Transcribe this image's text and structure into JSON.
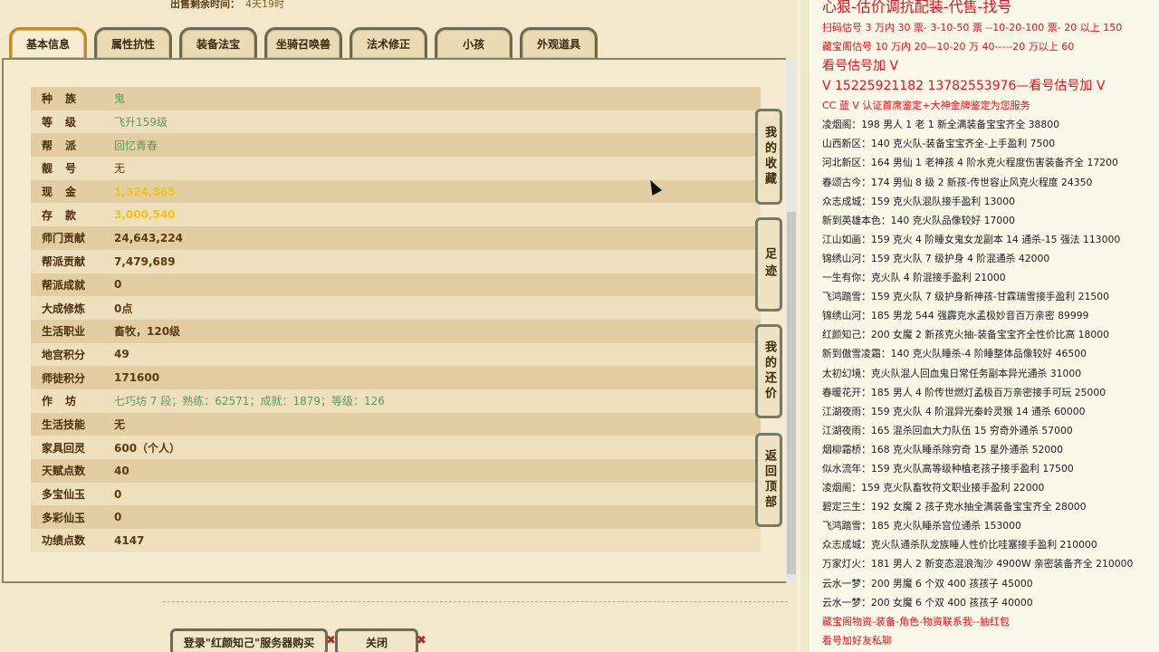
{
  "sale_time": {
    "label": "出售剩余时间：",
    "value": "4天19时"
  },
  "tabs": [
    "基本信息",
    "属性抗性",
    "装备法宝",
    "坐骑召唤兽",
    "法术修正",
    "小孩",
    "外观道具"
  ],
  "attributes": [
    {
      "label": "种族",
      "value": "鬼",
      "style": "green",
      "spaced": true
    },
    {
      "label": "等级",
      "value": "飞升159级",
      "style": "green",
      "spaced": true
    },
    {
      "label": "帮派",
      "value": "回忆青春",
      "style": "green",
      "spaced": true
    },
    {
      "label": "靓号",
      "value": "无",
      "style": "plain",
      "spaced": true
    },
    {
      "label": "现金",
      "value": "1,324,865",
      "style": "gold",
      "spaced": true
    },
    {
      "label": "存款",
      "value": "3,000,540",
      "style": "gold",
      "spaced": true
    },
    {
      "label": "师门贡献",
      "value": "24,643,224",
      "style": "bold",
      "spaced": false
    },
    {
      "label": "帮派贡献",
      "value": "7,479,689",
      "style": "bold",
      "spaced": false
    },
    {
      "label": "帮派成就",
      "value": "0",
      "style": "bold",
      "spaced": false
    },
    {
      "label": "大成修炼",
      "value": "0点",
      "style": "bold",
      "spaced": false
    },
    {
      "label": "生活职业",
      "value": "畜牧，120级",
      "style": "bold",
      "spaced": false
    },
    {
      "label": "地宫积分",
      "value": "49",
      "style": "bold",
      "spaced": false
    },
    {
      "label": "师徒积分",
      "value": "171600",
      "style": "bold",
      "spaced": false
    },
    {
      "label": "作坊",
      "value": "七巧坊 7 段；熟练：62571；成就：1879；等级：126",
      "style": "green",
      "spaced": true
    },
    {
      "label": "生活技能",
      "value": "无",
      "style": "bold",
      "spaced": false
    },
    {
      "label": "家具回灵",
      "value": "600（个人）",
      "style": "bold",
      "spaced": false
    },
    {
      "label": "天赋点数",
      "value": "40",
      "style": "bold",
      "spaced": false
    },
    {
      "label": "多宝仙玉",
      "value": "0",
      "style": "bold",
      "spaced": false
    },
    {
      "label": "多彩仙玉",
      "value": "0",
      "style": "bold",
      "spaced": false
    },
    {
      "label": "功绩点数",
      "value": "4147",
      "style": "bold",
      "spaced": false
    }
  ],
  "side_buttons": {
    "favorites": "我的收藏",
    "footprint": "足迹",
    "bargain": "我的还价",
    "back_top": "返回顶部"
  },
  "bottom_buttons": {
    "login": "登录\"红颜知己\"服务器购买",
    "close": "关闭",
    "x": "✖"
  },
  "ad": {
    "title": "心狠-估价调抗配装-代售-找号",
    "lines": [
      {
        "text": "扫码估号 3 万内 30 票- 3-10-50 票 --10-20-100 票- 20 以上 150",
        "cls": "red"
      },
      {
        "text": "藏宝阁估号 10 万内 20—10-20 万 40-----20 万以上 60",
        "cls": "red"
      },
      {
        "text": "看号估号加 V",
        "cls": "red14"
      },
      {
        "text": "V 15225921182     13782553976—看号估号加 V",
        "cls": "red14"
      },
      {
        "text": "CC 蓝 V 认证首席鉴定+大神金牌鉴定为您服务",
        "cls": "red"
      },
      {
        "text": "凌烟阁：198 男人 1 老 1 新全满装备宝宝齐全 38800",
        "cls": ""
      },
      {
        "text": "山西新区：140 克火队-装备宝宝齐全-上手盈利 7500",
        "cls": ""
      },
      {
        "text": "河北新区：164 男仙 1 老神孩 4 阶水克火程度伤害装备齐全 17200",
        "cls": ""
      },
      {
        "text": "春颂古今：174 男仙 8 级 2 新孩-传世容止风克火程度 24350",
        "cls": ""
      },
      {
        "text": "众志成城：159 克火队混队接手盈利 13000",
        "cls": ""
      },
      {
        "text": "新到英雄本色：140 克火队品像较好 17000",
        "cls": ""
      },
      {
        "text": "江山如画：159 克火 4 阶睡女鬼女龙副本 14 通杀-15 强法 113000",
        "cls": ""
      },
      {
        "text": "锦绣山河：159 克火队 7 级护身 4 阶混通杀 42000",
        "cls": ""
      },
      {
        "text": "一生有你：克火队 4 阶混接手盈利 21000",
        "cls": ""
      },
      {
        "text": "飞鸿踏雪：159 克火队 7 级护身新神孩-甘霖瑞雪接手盈利 21500",
        "cls": ""
      },
      {
        "text": "锦绣山河：185 男龙 544 强霹克水孟极妙音百万亲密 89999",
        "cls": ""
      },
      {
        "text": "红颜知己：200 女魔 2 新孩克火抽-装备宝宝齐全性价比高 18000",
        "cls": ""
      },
      {
        "text": "新到傲雪凌霜：140 克火队睡杀-4 阶睡整体品像较好 46500",
        "cls": ""
      },
      {
        "text": "太初幻境：克火队混人回血鬼日常任务副本异光通杀 31000",
        "cls": ""
      },
      {
        "text": "春暖花开：185 男人 4 阶传世燃灯孟极百万亲密接手可玩 25000",
        "cls": ""
      },
      {
        "text": "江湖夜雨：159 克火队 4 阶混异光秦岭灵猴 14 通杀 60000",
        "cls": ""
      },
      {
        "text": "江湖夜雨：165 混杀回血大力队伍 15 穷奇外通杀 57000",
        "cls": ""
      },
      {
        "text": "烟柳霜桥：168 克火队睡杀除穷奇 15 星外通杀 52000",
        "cls": ""
      },
      {
        "text": "似水流年：159 克火队高等级种植老孩子接手盈利 17500",
        "cls": ""
      },
      {
        "text": "凌烟阁：159 克火队畜牧符文职业接手盈利 22000",
        "cls": ""
      },
      {
        "text": "碧定三生：192 女魔 2 孩子克水抽全满装备宝宝齐全 28000",
        "cls": ""
      },
      {
        "text": "飞鸿踏雪：185 克火队睡杀宫位通杀 153000",
        "cls": ""
      },
      {
        "text": "众志成城：克火队通杀队龙族睡人性价比哇塞接手盈利 210000",
        "cls": ""
      },
      {
        "text": "万家灯火：181 男人 2 新变态混浪淘沙 4900W 亲密装备齐全 210000",
        "cls": ""
      },
      {
        "text": "云水一梦：200 男魔 6 个双 400 孩孩子 45000",
        "cls": ""
      },
      {
        "text": "云水一梦：200 女魔 6 个双 400 孩孩子 40000",
        "cls": ""
      },
      {
        "text": "藏宝阁物资-装备-角色-物资联系我--抽红包",
        "cls": "red"
      },
      {
        "text": "看号加好友私聊",
        "cls": "red"
      }
    ]
  }
}
